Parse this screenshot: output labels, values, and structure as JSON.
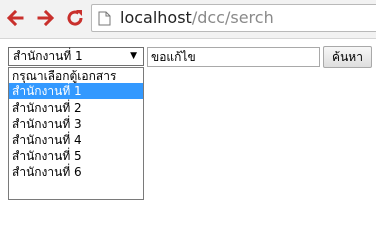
{
  "browser": {
    "url_host": "localhost",
    "url_path": "/dcc/serch",
    "icons": [
      "back-arrow-icon",
      "forward-arrow-icon",
      "reload-icon",
      "page-icon"
    ]
  },
  "form": {
    "select_value": "สำนักงานที่ 1",
    "text_value": "ขอแก้ไข",
    "search_button_label": "ค้นหา",
    "options": [
      "กรุณาเลือกตู้เอกสาร",
      "สำนักงานที่ 1",
      "สำนักงานที่ 2",
      "สำนักงานที่ 3",
      "สำนักงานที่ 4",
      "สำนักงานที่ 5",
      "สำนักงานที่ 6"
    ],
    "selected_option": "สำนักงานที่ 1"
  },
  "colors": {
    "selection": "#3399ff",
    "nav_icons": "#c9302c"
  }
}
